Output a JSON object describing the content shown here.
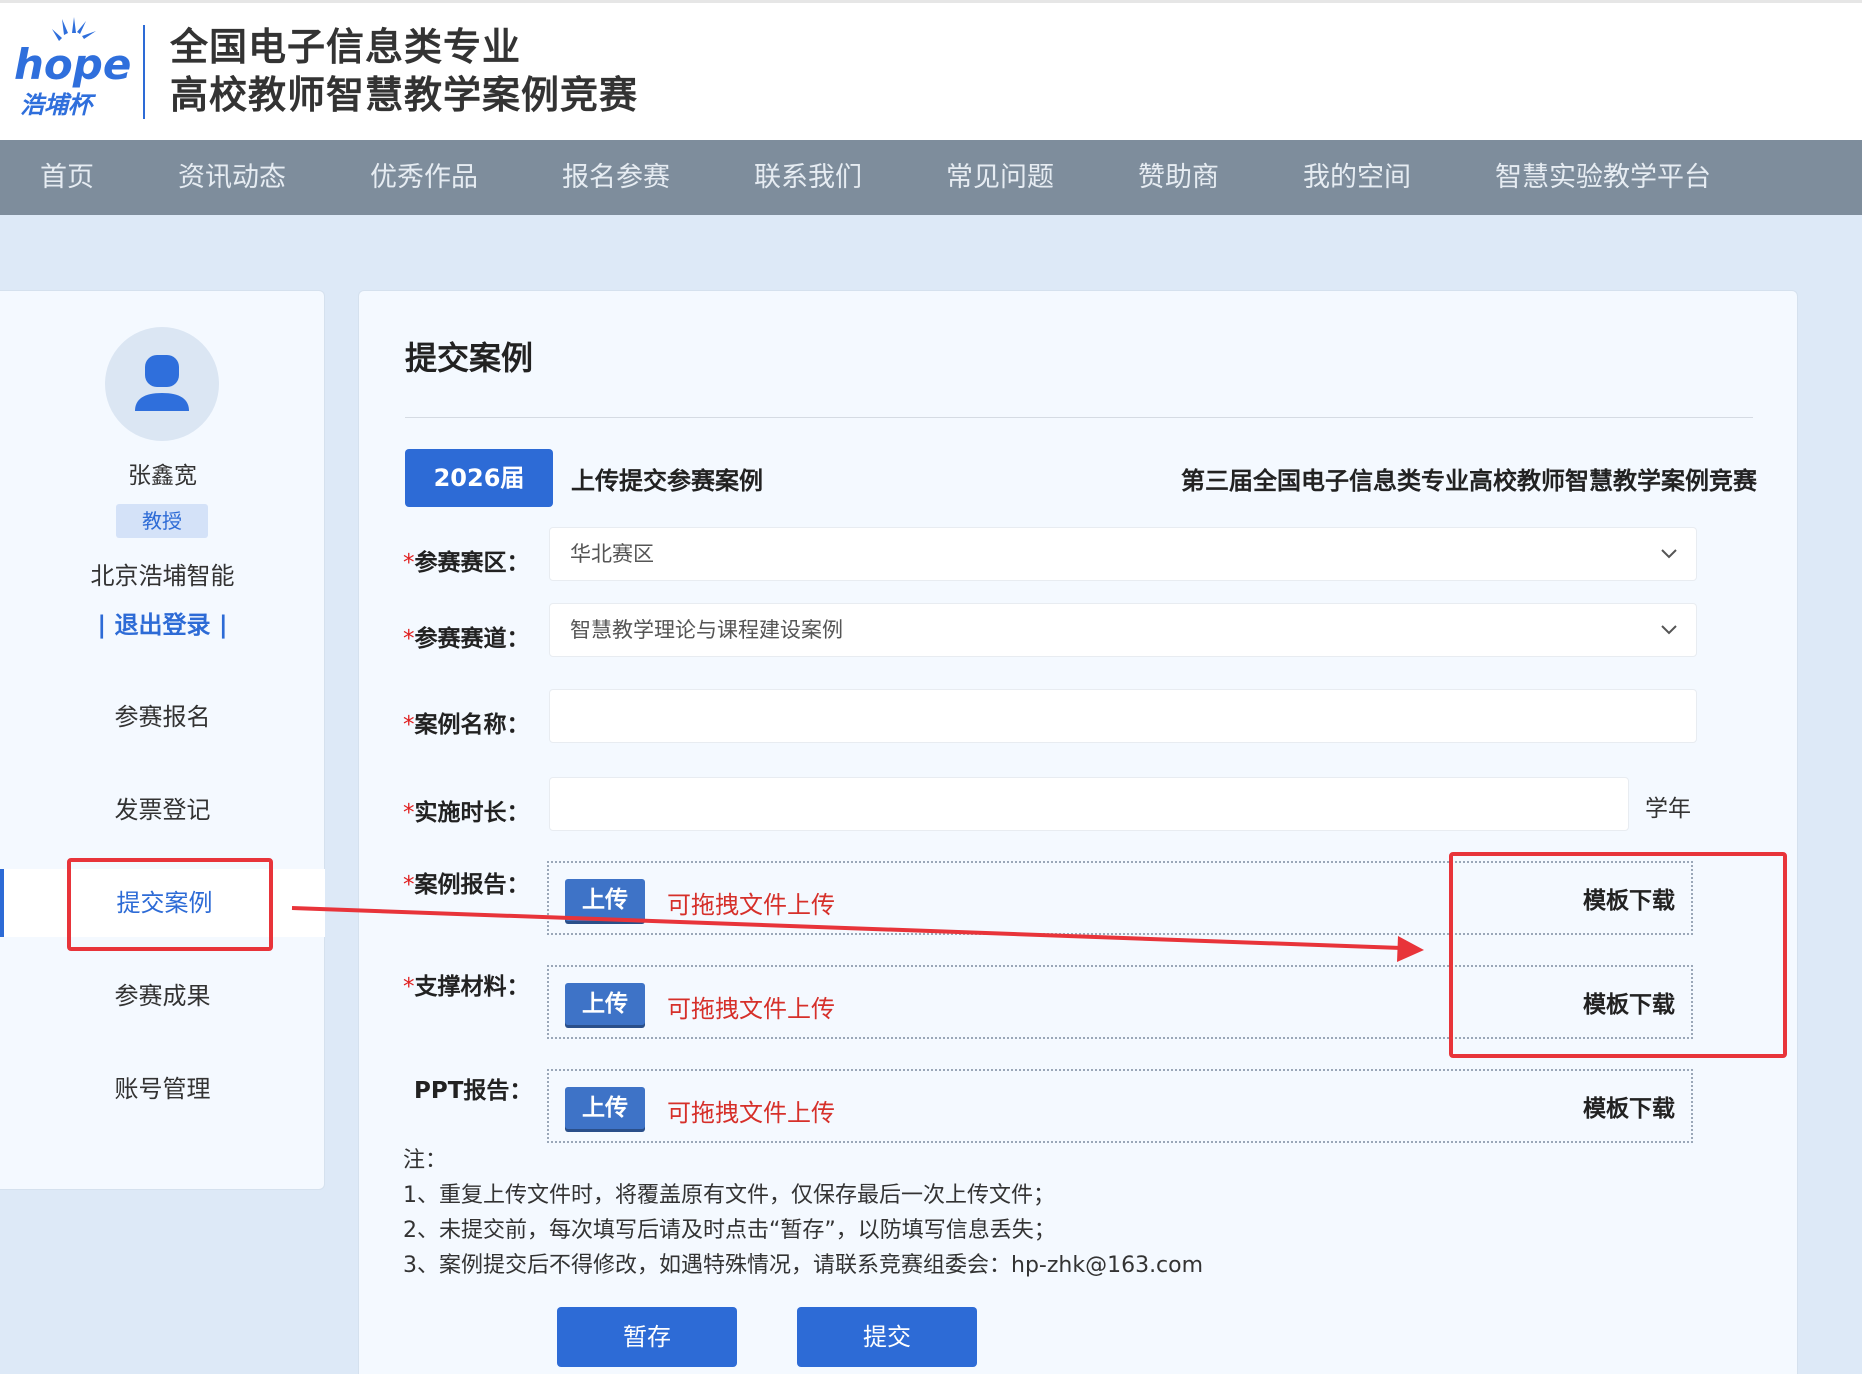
{
  "header": {
    "logo_text": "hope",
    "logo_sub": "浩埔杯",
    "title_line1": "全国电子信息类专业",
    "title_line2": "高校教师智慧教学案例竞赛"
  },
  "nav": {
    "items": [
      "首页",
      "资讯动态",
      "优秀作品",
      "报名参赛",
      "联系我们",
      "常见问题",
      "赞助商",
      "我的空间",
      "智慧实验教学平台"
    ]
  },
  "sidebar": {
    "user_name": "张鑫宽",
    "role": "教授",
    "org": "北京浩埔智能",
    "logout": "| 退出登录 |",
    "items": [
      "参赛报名",
      "发票登记",
      "提交案例",
      "参赛成果",
      "账号管理"
    ],
    "active_item": "提交案例"
  },
  "main": {
    "page_title": "提交案例",
    "year_button": "2026届",
    "upload_heading": "上传提交参赛案例",
    "contest_name": "第三届全国电子信息类专业高校教师智慧教学案例竞赛",
    "fields": {
      "region_label": "参赛赛区：",
      "region_value": "华北赛区",
      "track_label": "参赛赛道：",
      "track_value": "智慧教学理论与课程建设案例",
      "case_name_label": "案例名称：",
      "case_name_value": "",
      "duration_label": "实施时长：",
      "duration_value": "",
      "duration_unit": "学年",
      "report_label": "案例报告：",
      "material_label": "支撑材料：",
      "ppt_label": "PPT报告："
    },
    "required_mark": "*",
    "upload_button": "上传",
    "drag_hint": "可拖拽文件上传",
    "template_download": "模板下载",
    "notes": {
      "title": "注：",
      "line1": "1、重复上传文件时，将覆盖原有文件，仅保存最后一次上传文件；",
      "line2": "2、未提交前，每次填写后请及时点击“暂存”，以防填写信息丢失；",
      "line3": "3、案例提交后不得修改，如遇特殊情况，请联系竞赛组委会：hp-zhk@163.com"
    },
    "save_button": "暂存",
    "submit_button": "提交"
  },
  "colors": {
    "primary": "#2d6bd6",
    "nav_bg": "#7e8d9c",
    "annotation_red": "#e8343a",
    "hint_red": "#d6302a"
  }
}
